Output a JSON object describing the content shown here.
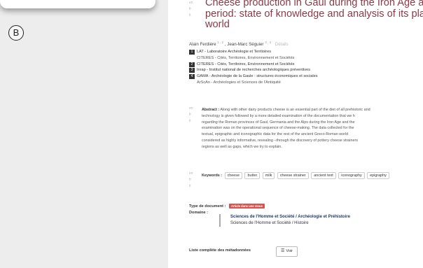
{
  "figure": {
    "panel_label": "B"
  },
  "record": {
    "lang_codes": [
      "en",
      "fr",
      "it"
    ],
    "title_lines": [
      "Cheese production in Gaul during the Iron Age and Roman",
      "period: state of knowledge and analysis of its place in the",
      "world"
    ],
    "authors": {
      "a1_name": "Alain Ferdière",
      "a1_sup": "1 , 2",
      "a2_name": "Jean-Marc Séguier",
      "a2_sup": "3 , 4",
      "details_label": "Détails"
    },
    "affiliations": [
      {
        "num": "1",
        "name": "LAT - Laboratoire Archéologie et Territoires"
      },
      {
        "num": "",
        "name": "CITERES - Cités, Territoires, Environnement et Sociétés"
      },
      {
        "num": "2",
        "name": "CITERES - Cités, Territoires, Environnement et Sociétés"
      },
      {
        "num": "3",
        "name": "Inrap - Institut national de recherches archéologiques préventives"
      },
      {
        "num": "4",
        "name": "GAMA - Archéologie de la Gaule : structures économiques et sociales"
      },
      {
        "num": "",
        "name": "ArScAn - Archéologies et Sciences de l'Antiquité"
      }
    ],
    "abstract": {
      "label": "Abstract :",
      "lines": [
        "Along with other dairy products cheese is an essential part of the diet of all prehistoric and",
        "technology is given followed by a more detailed examination of the documentation that we h",
        "regarding the Roman provinces of Gaul, Germania and the Alps during the Iron Age and the",
        "examination was on the operational sequence of cheese-making. The data collected for the",
        "textual, epigraphic and iconographic data for the rest of the ancient Greco-Roman world",
        "considered as highly informative, revealing –through the discovery of pottery cheese strainers",
        "regions as well as gaps, which we try to explain."
      ]
    },
    "keywords": {
      "label": "Keywords :",
      "items": [
        "cheese",
        "butter",
        "milk",
        "cheese strainer",
        "ancient text",
        "iconography",
        "epigraphy"
      ]
    },
    "doc_type": {
      "label": "Type de document :",
      "value": "Article dans une revue"
    },
    "domain": {
      "label": "Domaine :",
      "line1": "Sciences de l'Homme et Société / Archéologie et Préhistoire",
      "line2": "Sciences de l'Homme et Société / Histoire"
    },
    "metadata": {
      "label": "Liste complète des métadonnées",
      "button": "Voir",
      "button_icon": "list-icon"
    }
  }
}
